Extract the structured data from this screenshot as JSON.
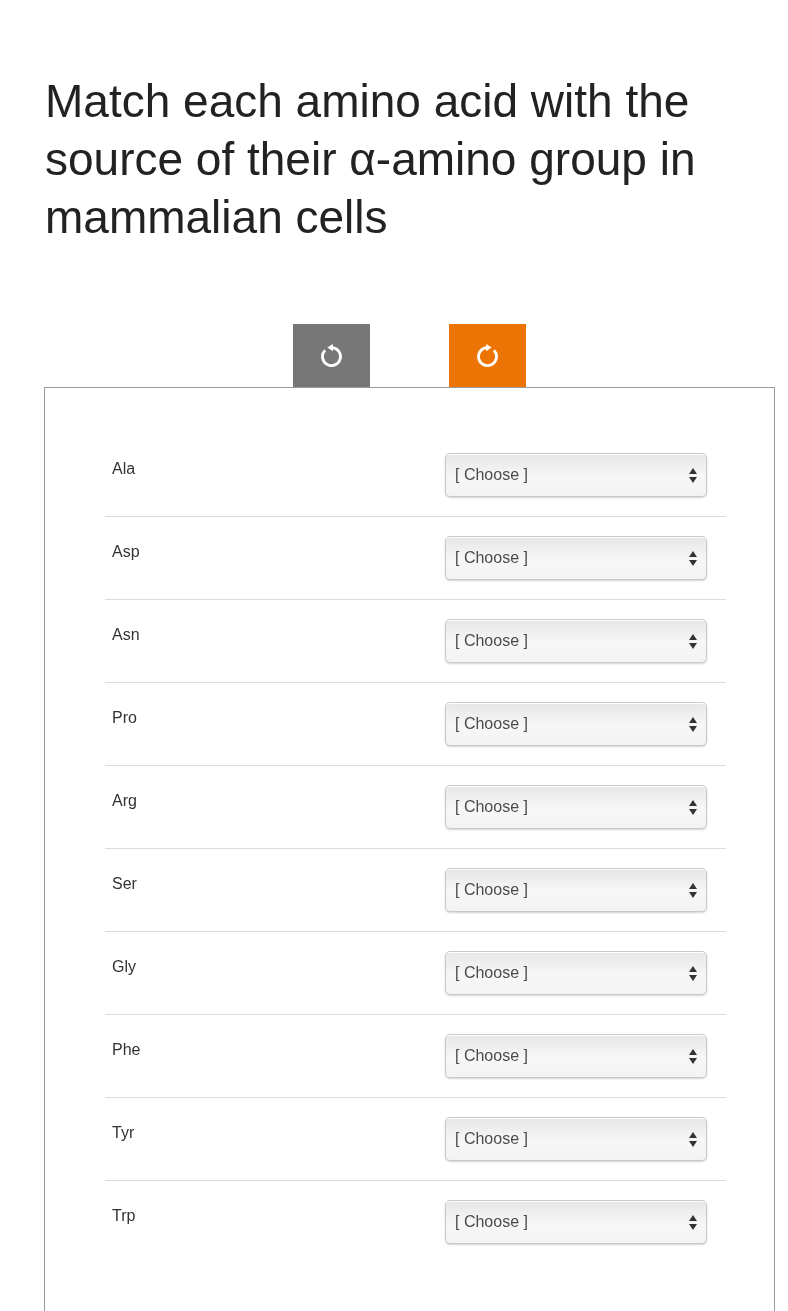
{
  "question": {
    "title": "Match each amino acid with the source of their α-amino group in mammalian cells"
  },
  "buttons": [
    {
      "kind": "undo",
      "color": "#777777"
    },
    {
      "kind": "redo",
      "color": "#ec7404"
    }
  ],
  "rows": [
    {
      "label": "Ala",
      "value": "[ Choose ]"
    },
    {
      "label": "Asp",
      "value": "[ Choose ]"
    },
    {
      "label": "Asn",
      "value": "[ Choose ]"
    },
    {
      "label": "Pro",
      "value": "[ Choose ]"
    },
    {
      "label": "Arg",
      "value": "[ Choose ]"
    },
    {
      "label": "Ser",
      "value": "[ Choose ]"
    },
    {
      "label": "Gly",
      "value": "[ Choose ]"
    },
    {
      "label": "Phe",
      "value": "[ Choose ]"
    },
    {
      "label": "Tyr",
      "value": "[ Choose ]"
    },
    {
      "label": "Trp",
      "value": "[ Choose ]"
    }
  ]
}
